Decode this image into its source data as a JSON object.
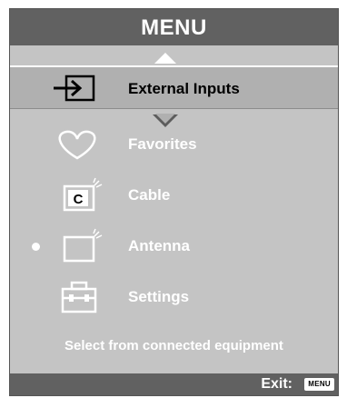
{
  "menu": {
    "title": "MENU",
    "items": [
      {
        "label": "External Inputs",
        "icon": "input-icon",
        "selected": true,
        "active": false
      },
      {
        "label": "Favorites",
        "icon": "heart-icon",
        "selected": false,
        "active": false
      },
      {
        "label": "Cable",
        "icon": "cable-icon",
        "icon_text": "C",
        "selected": false,
        "active": false
      },
      {
        "label": "Antenna",
        "icon": "antenna-icon",
        "selected": false,
        "active": true
      },
      {
        "label": "Settings",
        "icon": "toolbox-icon",
        "selected": false,
        "active": false
      }
    ],
    "hint": "Select from connected equipment",
    "exit_label": "Exit:",
    "exit_button": "MENU"
  },
  "colors": {
    "background": "#c4c4c4",
    "title_bar": "#616161",
    "selected_row": "#b0b0b0",
    "label": "#ffffff",
    "selected_label": "#000000"
  }
}
